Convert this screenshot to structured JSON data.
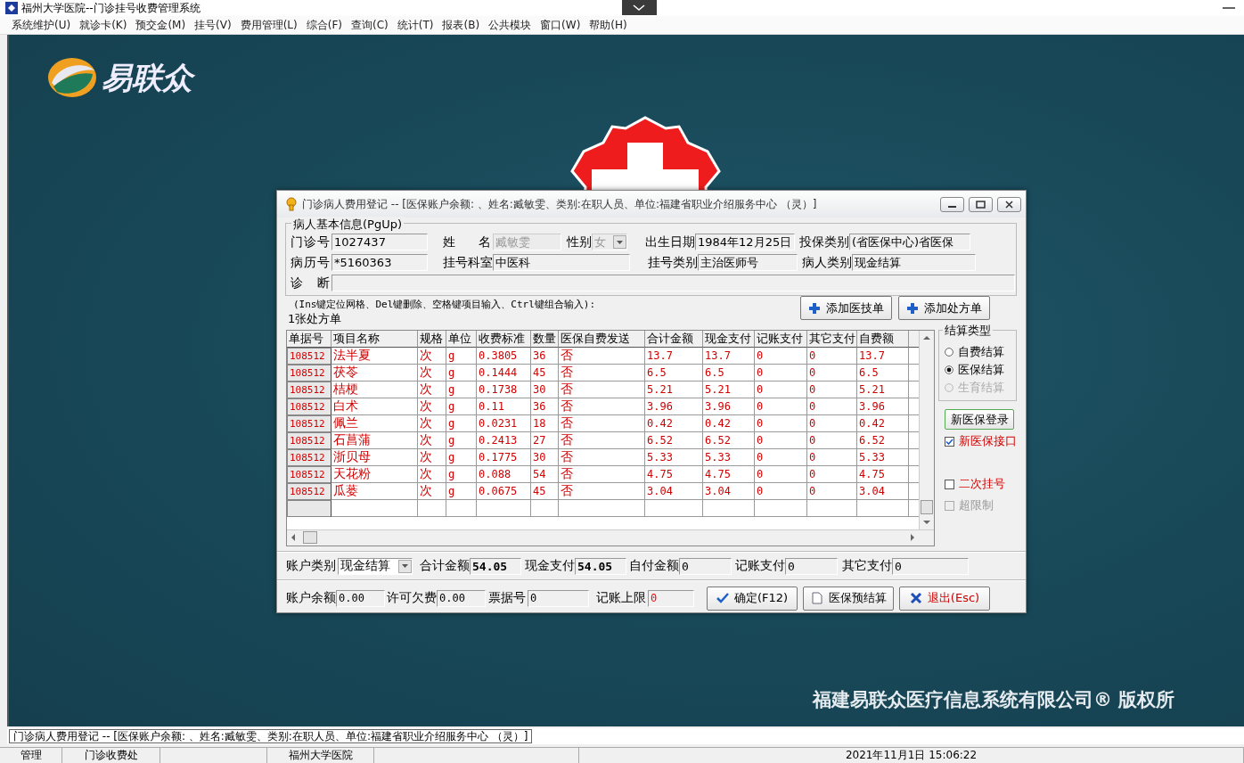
{
  "window": {
    "title": "福州大学医院--门诊挂号收费管理系统"
  },
  "menu": [
    "系统维护(U)",
    "就诊卡(K)",
    "预交金(M)",
    "挂号(V)",
    "费用管理(L)",
    "综合(F)",
    "查询(C)",
    "统计(T)",
    "报表(B)",
    "公共模块",
    "窗口(W)",
    "帮助(H)"
  ],
  "logo": {
    "text": "易联众"
  },
  "copyright": "福建易联众医疗信息系统有限公司® 版权所",
  "dialog": {
    "title": "门诊病人费用登记 -- [医保账户余额: 、姓名:臧敏雯、类别:在职人员、单位:福建省职业介绍服务中心 （灵）]",
    "patient": {
      "title": "病人基本信息(PgUp)",
      "fields": [
        {
          "label": "门诊号",
          "value": "1027437",
          "kind": "text",
          "disabled": false
        },
        {
          "label": "姓 名",
          "value": "臧敏雯",
          "kind": "text",
          "disabled": true
        },
        {
          "label": "性别",
          "value": "女",
          "kind": "combo",
          "disabled": true
        },
        {
          "label": "出生日期",
          "value": "1984年12月25日",
          "kind": "text",
          "disabled": false
        },
        {
          "label": "投保类别",
          "value": "(省医保中心)省医保",
          "kind": "text",
          "disabled": false
        },
        {
          "label": "病历号",
          "value": "*5160363",
          "kind": "text",
          "disabled": false
        },
        {
          "label": "挂号科室",
          "value": "中医科",
          "kind": "text",
          "disabled": false
        },
        {
          "label": "挂号类别",
          "value": "主治医师号",
          "kind": "text",
          "disabled": false
        },
        {
          "label": "病人类别",
          "value": "现金结算",
          "kind": "text",
          "disabled": false
        },
        {
          "label": "诊 断",
          "kind": "text",
          "disabled": false
        }
      ]
    },
    "hint": "(Ins键定位网格、Del键删除、空格键项目输入、Ctrl键组合输入):",
    "count_label": "1张处方单",
    "add_buttons": [
      "添加医技单",
      "添加处方单"
    ],
    "table": {
      "columns": [
        "单据号",
        "项目名称",
        "规格",
        "单位",
        "收费标准",
        "数量",
        "医保自费发送",
        "合计金额",
        "现金支付",
        "记账支付",
        "其它支付",
        "自费额"
      ],
      "rows": [
        [
          "108512",
          "法半夏",
          "次",
          "g",
          "0.3805",
          "36",
          "否",
          "13.7",
          "13.7",
          "0",
          "0",
          "13.7"
        ],
        [
          "108512",
          "茯苓",
          "次",
          "g",
          "0.1444",
          "45",
          "否",
          "6.5",
          "6.5",
          "0",
          "0",
          "6.5"
        ],
        [
          "108512",
          "桔梗",
          "次",
          "g",
          "0.1738",
          "30",
          "否",
          "5.21",
          "5.21",
          "0",
          "0",
          "5.21"
        ],
        [
          "108512",
          "白术",
          "次",
          "g",
          "0.11",
          "36",
          "否",
          "3.96",
          "3.96",
          "0",
          "0",
          "3.96"
        ],
        [
          "108512",
          "佩兰",
          "次",
          "g",
          "0.0231",
          "18",
          "否",
          "0.42",
          "0.42",
          "0",
          "0",
          "0.42"
        ],
        [
          "108512",
          "石菖蒲",
          "次",
          "g",
          "0.2413",
          "27",
          "否",
          "6.52",
          "6.52",
          "0",
          "0",
          "6.52"
        ],
        [
          "108512",
          "浙贝母",
          "次",
          "g",
          "0.1775",
          "30",
          "否",
          "5.33",
          "5.33",
          "0",
          "0",
          "5.33"
        ],
        [
          "108512",
          "天花粉",
          "次",
          "g",
          "0.088",
          "54",
          "否",
          "4.75",
          "4.75",
          "0",
          "0",
          "4.75"
        ],
        [
          "108512",
          "瓜蒌",
          "次",
          "g",
          "0.0675",
          "45",
          "否",
          "3.04",
          "3.04",
          "0",
          "0",
          "3.04"
        ]
      ]
    },
    "settlement": {
      "title": "结算类型",
      "options": [
        {
          "label": "自费结算",
          "selected": false,
          "disabled": false
        },
        {
          "label": "医保结算",
          "selected": true,
          "disabled": false
        },
        {
          "label": "生育结算",
          "selected": false,
          "disabled": true
        }
      ]
    },
    "login_button": "新医保登录",
    "checks": [
      {
        "label": "新医保接口",
        "checked": true,
        "disabled": false
      },
      {
        "label": "二次挂号",
        "checked": false,
        "disabled": false
      },
      {
        "label": "超限制",
        "checked": false,
        "disabled": true
      }
    ],
    "totals": [
      {
        "label": "账户类别",
        "value": "现金结算",
        "kind": "combo",
        "bold": false
      },
      {
        "label": "合计金额",
        "value": "54.05",
        "kind": "text",
        "bold": true
      },
      {
        "label": "现金支付",
        "value": "54.05",
        "kind": "text",
        "bold": true
      },
      {
        "label": "自付金额",
        "value": "0",
        "kind": "text",
        "bold": false
      },
      {
        "label": "记账支付",
        "value": "0",
        "kind": "text",
        "bold": false
      },
      {
        "label": "其它支付",
        "value": "0",
        "kind": "text",
        "bold": false
      }
    ],
    "account": [
      {
        "label": "账户余额",
        "value": "0.00"
      },
      {
        "label": "许可欠费",
        "value": "0.00"
      },
      {
        "label": "票据号",
        "value": "0"
      },
      {
        "label": "记账上限",
        "value": "0",
        "color": "#ff0000"
      }
    ],
    "buttons": [
      {
        "label": "确定(F12)",
        "kind": "confirm"
      },
      {
        "label": "医保预结算",
        "kind": "document"
      },
      {
        "label": "退出(Esc)",
        "kind": "exit"
      }
    ]
  },
  "status_line": "门诊病人费用登记 -- [医保账户余额: 、姓名:臧敏雯、类别:在职人员、单位:福建省职业介绍服务中心 （灵）]",
  "status_bar": [
    "管理",
    "门诊收费处",
    "福州大学医院",
    "2021年11月1日 15:06:22"
  ]
}
